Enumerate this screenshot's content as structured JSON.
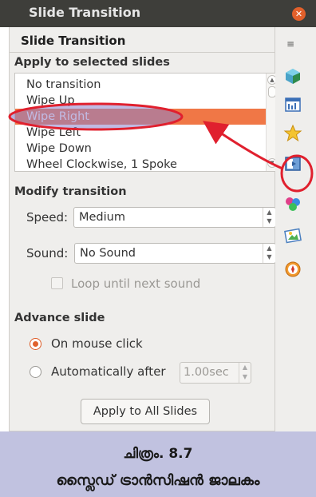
{
  "window": {
    "title": "Slide Transition"
  },
  "panel": {
    "title": "Slide Transition"
  },
  "apply_section": {
    "heading": "Apply to selected slides",
    "transitions": [
      "No transition",
      "Wipe Up",
      "Wipe Right",
      "Wipe Left",
      "Wipe Down",
      "Wheel Clockwise, 1 Spoke"
    ],
    "selected": "Wipe Right"
  },
  "modify_section": {
    "heading": "Modify transition",
    "speed_label": "Speed:",
    "speed_value": "Medium",
    "sound_label": "Sound:",
    "sound_value": "No Sound",
    "loop_label": "Loop until next sound",
    "loop_checked": false
  },
  "advance_section": {
    "heading": "Advance slide",
    "on_click_label": "On mouse click",
    "auto_label": "Automatically after",
    "auto_value": "1.00sec",
    "selected_option": "On mouse click"
  },
  "apply_all_button": "Apply to All Slides",
  "deck_icons": [
    "menu-icon",
    "cube-icon",
    "layout-icon",
    "star-icon",
    "slide-transition-icon",
    "animation-icon",
    "gallery-icon",
    "navigator-icon"
  ],
  "caption": {
    "line1": "ചിത്രം. 8.7",
    "line2": "സ്ലൈഡ് ട്രാൻസിഷൻ ജാലകം"
  },
  "colors": {
    "selection": "#f07746",
    "highlight_fill": "#8c82cc",
    "annotation_red": "#e0202e",
    "caption_bg": "#c1c2e0",
    "titlebar": "#3e3e3a"
  }
}
